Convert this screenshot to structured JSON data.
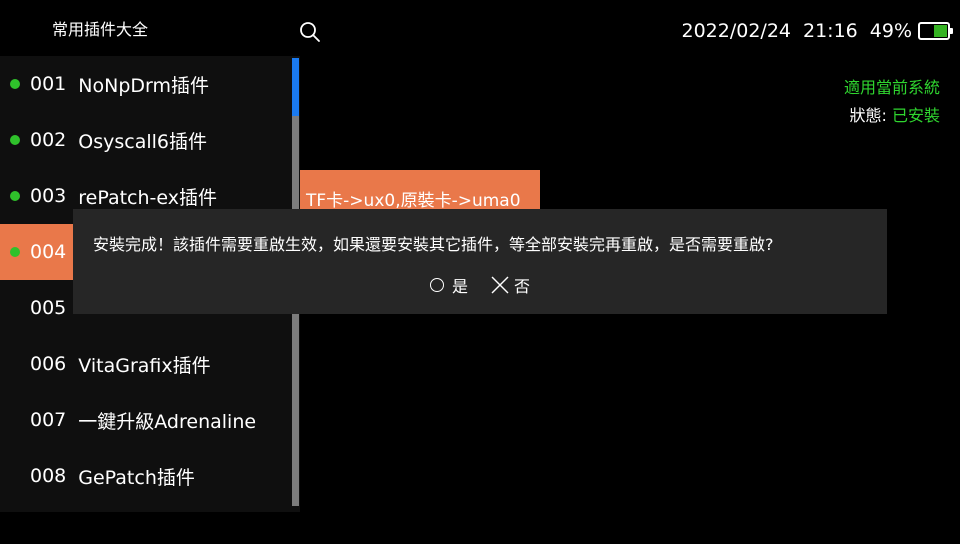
{
  "header": {
    "title": "常用插件大全",
    "search_icon": "search-icon"
  },
  "status": {
    "date": "2022/02/24",
    "time": "21:16",
    "battery_text": "49%",
    "battery_level": 0.49,
    "battery_color": "#36b324"
  },
  "plugins": [
    {
      "num": "001",
      "name": "NoNpDrm插件",
      "installed": true,
      "selected": false
    },
    {
      "num": "002",
      "name": "Osyscall6插件",
      "installed": true,
      "selected": false
    },
    {
      "num": "003",
      "name": "rePatch-ex插件",
      "installed": true,
      "selected": false
    },
    {
      "num": "004",
      "name": "",
      "installed": true,
      "selected": true
    },
    {
      "num": "005",
      "name": "",
      "installed": false,
      "selected": false
    },
    {
      "num": "006",
      "name": "VitaGrafix插件",
      "installed": false,
      "selected": false
    },
    {
      "num": "007",
      "name": "一鍵升級Adrenaline",
      "installed": false,
      "selected": false
    },
    {
      "num": "008",
      "name": "GePatch插件",
      "installed": false,
      "selected": false
    }
  ],
  "scrollbar": {
    "position": 0
  },
  "system": {
    "applicable": "適用當前系統",
    "status_label": "狀態: ",
    "status_value": "已安裝"
  },
  "path_option": "TF卡->ux0,原裝卡->uma0",
  "dialog": {
    "message": "安裝完成！該插件需要重啟生效，如果還要安裝其它插件，等全部安裝完再重啟，是否需要重啟?",
    "yes_label": "是",
    "no_label": "否",
    "yes_icon": "circle-icon",
    "no_icon": "cross-icon"
  },
  "colors": {
    "accent": "#e9784a",
    "installed_dot": "#2fc12b",
    "status_green": "#2fd52f",
    "scroll_thumb": "#1a7af0"
  }
}
